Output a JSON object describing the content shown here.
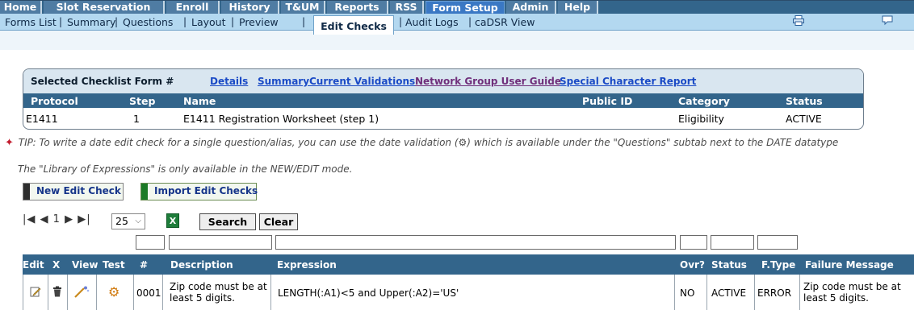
{
  "topnav": {
    "tabs": [
      {
        "label": "Home"
      },
      {
        "label": "Slot Reservation"
      },
      {
        "label": "Enroll"
      },
      {
        "label": "History"
      },
      {
        "label": "T&UM"
      },
      {
        "label": "Reports"
      },
      {
        "label": "RSS"
      },
      {
        "label": "Form Setup",
        "active": true
      },
      {
        "label": "Admin"
      },
      {
        "label": "Help"
      }
    ]
  },
  "subnav": {
    "items": [
      "Forms List",
      "Summary",
      "Questions",
      "Layout",
      "Preview",
      "Edit Checks",
      "Audit Logs",
      "caDSR View"
    ],
    "separator": "|",
    "icons": [
      "printer-icon",
      "chat-bubble-icon"
    ]
  },
  "checklist": {
    "label": "Selected Checklist Form #",
    "links": [
      "Details",
      "Summary",
      "Current Validations",
      "Network Group User Guide",
      "Special Character Report"
    ],
    "columns": [
      "Protocol",
      "Step",
      "Name",
      "Public ID",
      "Category",
      "Status"
    ],
    "row": {
      "protocol": "E1411",
      "step": "1",
      "name": "E1411 Registration Worksheet (step 1)",
      "public_id": "",
      "category": "Eligibility",
      "status": "ACTIVE"
    }
  },
  "tips": {
    "line1_a": "TIP: To write a date edit check for a single question/alias, you can use the date validation (",
    "line1_icon": "⚙",
    "line1_b": ") which is available under the \"Questions\" subtab next to the DATE datatype",
    "line2": "The \"Library of Expressions\" is only available in the NEW/EDIT mode."
  },
  "actions": {
    "new_label": "New Edit Check",
    "import_label": "Import Edit Checks"
  },
  "pager": {
    "first": "|◀",
    "prev": "◀",
    "page": "1",
    "next": "▶",
    "last": "▶|",
    "page_size": "25",
    "search_label": "Search",
    "clear_label": "Clear"
  },
  "grid": {
    "headers": [
      "Edit",
      "X",
      "View",
      "Test",
      "#",
      "Description",
      "Expression",
      "Ovr?",
      "Status",
      "F.Type",
      "Failure Message"
    ],
    "rows": [
      {
        "number": "0001",
        "description": "Zip code must be at least 5 digits.",
        "expression": "LENGTH(:A1)<5 and Upper(:A2)='US'",
        "ovr": "NO",
        "status": "ACTIVE",
        "ftype": "ERROR",
        "failure_message": "Zip code must be at least 5 digits."
      }
    ]
  },
  "colors": {
    "nav_bg": "#33658b",
    "tab_active": "#3a78c4",
    "subnav_bg": "#b3d8f0",
    "link": "#1b4bc6",
    "visited_link": "#702f7b",
    "tip_pin": "#c21c2e"
  }
}
